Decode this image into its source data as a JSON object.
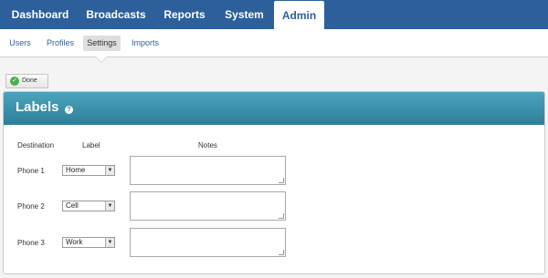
{
  "topnav": {
    "tabs": [
      {
        "label": "Dashboard",
        "active": false
      },
      {
        "label": "Broadcasts",
        "active": false
      },
      {
        "label": "Reports",
        "active": false
      },
      {
        "label": "System",
        "active": false
      },
      {
        "label": "Admin",
        "active": true
      }
    ]
  },
  "subnav": {
    "items": [
      {
        "label": "Users",
        "active": false
      },
      {
        "label": "Profiles",
        "active": false
      },
      {
        "label": "Settings",
        "active": true
      },
      {
        "label": "Imports",
        "active": false
      }
    ]
  },
  "toolbar": {
    "done_label": "Done"
  },
  "panel": {
    "title": "Labels",
    "help_icon": "help-icon",
    "columns": {
      "destination": "Destination",
      "label": "Label",
      "notes": "Notes"
    },
    "rows": [
      {
        "destination": "Phone 1",
        "label": "Home",
        "notes": ""
      },
      {
        "destination": "Phone 2",
        "label": "Cell",
        "notes": ""
      },
      {
        "destination": "Phone 3",
        "label": "Work",
        "notes": ""
      }
    ]
  },
  "colors": {
    "nav": "#2d5f9a",
    "header_top": "#4aa4bd",
    "header_bottom": "#2e7f98",
    "done_check": "#49b04b"
  }
}
